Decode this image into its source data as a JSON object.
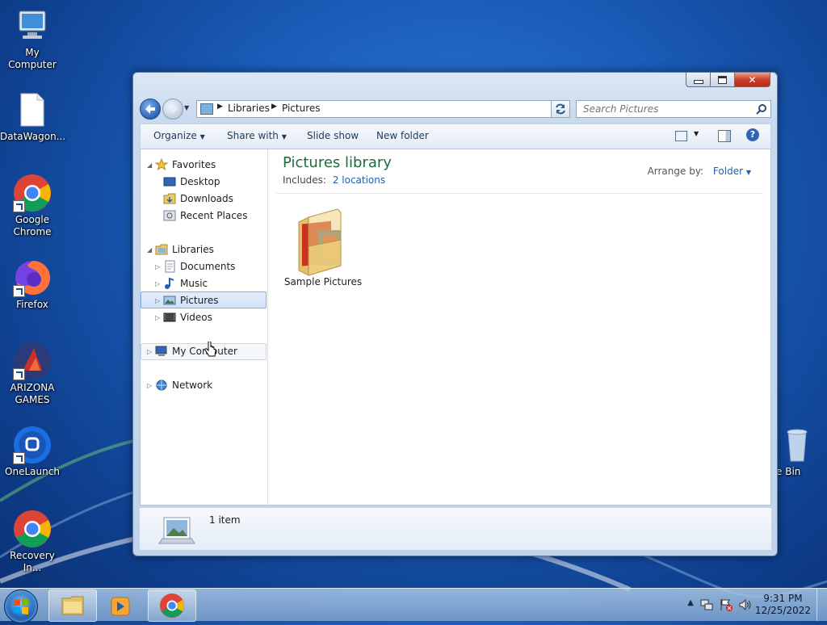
{
  "desktop": {
    "icons": [
      {
        "label": "My Computer",
        "icon": "my-computer-icon"
      },
      {
        "label": "DataWagon...",
        "icon": "document-file-icon"
      },
      {
        "label": "Google Chrome",
        "icon": "chrome-icon"
      },
      {
        "label": "Firefox",
        "icon": "firefox-icon"
      },
      {
        "label": "ARIZONA GAMES",
        "icon": "arizona-games-icon"
      },
      {
        "label": "OneLaunch",
        "icon": "onelaunch-icon"
      },
      {
        "label": "Recovery In...",
        "icon": "chrome-icon"
      },
      {
        "label": "ycle Bin",
        "icon": "recycle-bin-icon"
      }
    ]
  },
  "window": {
    "breadcrumb": [
      "Libraries",
      "Pictures"
    ],
    "search_placeholder": "Search Pictures",
    "toolbar": {
      "organize": "Organize",
      "share_with": "Share with",
      "slide_show": "Slide show",
      "new_folder": "New folder"
    },
    "nav": {
      "favorites": "Favorites",
      "favorites_items": [
        "Desktop",
        "Downloads",
        "Recent Places"
      ],
      "libraries": "Libraries",
      "libraries_items": [
        "Documents",
        "Music",
        "Pictures",
        "Videos"
      ],
      "computer": "My Computer",
      "network": "Network"
    },
    "main": {
      "title": "Pictures library",
      "includes_label": "Includes:",
      "includes_link": "2 locations",
      "arrange_label": "Arrange by:",
      "arrange_value": "Folder",
      "items": [
        {
          "label": "Sample Pictures",
          "icon": "folder-pictures-icon"
        }
      ]
    },
    "status": {
      "count": "1 item"
    }
  },
  "taskbar": {
    "apps": [
      "file-explorer-icon",
      "media-player-icon",
      "chrome-icon"
    ],
    "time": "9:31 PM",
    "date": "12/25/2022"
  },
  "colors": {
    "accent": "#1e5a9c",
    "title_green": "#1e6b3c",
    "link": "#1e5fb4"
  }
}
